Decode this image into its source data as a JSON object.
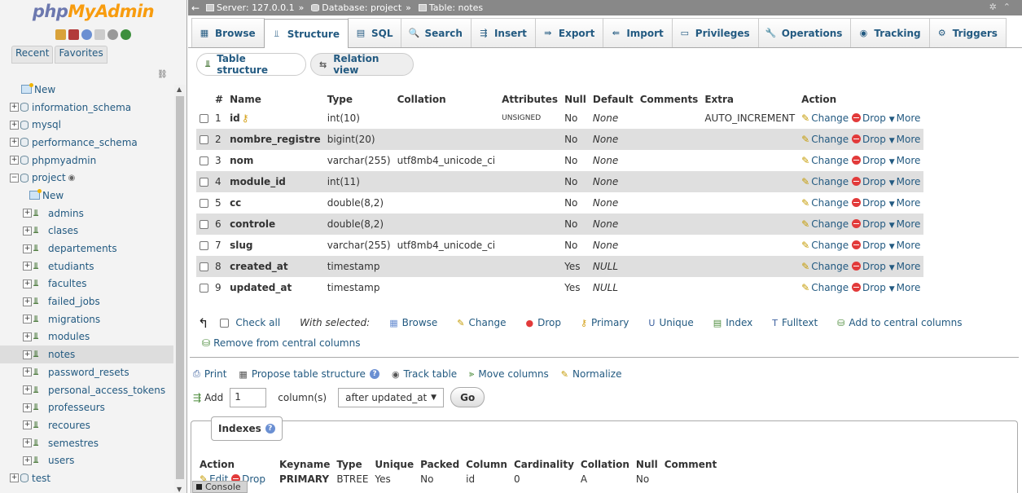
{
  "nav": {
    "logo_part1": "php",
    "logo_part2": "MyAdmin",
    "tabs": [
      "Recent",
      "Favorites"
    ],
    "items": [
      {
        "label": "New",
        "kind": "new",
        "level": 0
      },
      {
        "label": "information_schema",
        "kind": "db",
        "level": 0
      },
      {
        "label": "mysql",
        "kind": "db",
        "level": 0
      },
      {
        "label": "performance_schema",
        "kind": "db",
        "level": 0
      },
      {
        "label": "phpmyadmin",
        "kind": "db",
        "level": 0
      },
      {
        "label": "project",
        "kind": "db-open",
        "level": 0
      },
      {
        "label": "New",
        "kind": "new",
        "level": 1
      },
      {
        "label": "admins",
        "kind": "table",
        "level": 1
      },
      {
        "label": "clases",
        "kind": "table",
        "level": 1
      },
      {
        "label": "departements",
        "kind": "table",
        "level": 1
      },
      {
        "label": "etudiants",
        "kind": "table",
        "level": 1
      },
      {
        "label": "facultes",
        "kind": "table",
        "level": 1
      },
      {
        "label": "failed_jobs",
        "kind": "table",
        "level": 1
      },
      {
        "label": "migrations",
        "kind": "table",
        "level": 1
      },
      {
        "label": "modules",
        "kind": "table",
        "level": 1
      },
      {
        "label": "notes",
        "kind": "table",
        "level": 1,
        "selected": true
      },
      {
        "label": "password_resets",
        "kind": "table",
        "level": 1
      },
      {
        "label": "personal_access_tokens",
        "kind": "table",
        "level": 1
      },
      {
        "label": "professeurs",
        "kind": "table",
        "level": 1
      },
      {
        "label": "recoures",
        "kind": "table",
        "level": 1
      },
      {
        "label": "semestres",
        "kind": "table",
        "level": 1
      },
      {
        "label": "users",
        "kind": "table",
        "level": 1
      },
      {
        "label": "test",
        "kind": "db",
        "level": 0
      }
    ]
  },
  "breadcrumb": {
    "server": "Server: 127.0.0.1",
    "database": "Database: project",
    "table": "Table: notes",
    "separator": "»"
  },
  "menu": {
    "tabs": [
      {
        "label": "Browse",
        "icon": "browse-icon",
        "glyph": "▦"
      },
      {
        "label": "Structure",
        "icon": "structure-icon",
        "glyph": "⫫",
        "active": true
      },
      {
        "label": "SQL",
        "icon": "sql-icon",
        "glyph": "▤"
      },
      {
        "label": "Search",
        "icon": "search-icon",
        "glyph": "🔍"
      },
      {
        "label": "Insert",
        "icon": "insert-icon",
        "glyph": "⇶"
      },
      {
        "label": "Export",
        "icon": "export-icon",
        "glyph": "⇛"
      },
      {
        "label": "Import",
        "icon": "import-icon",
        "glyph": "⇚"
      },
      {
        "label": "Privileges",
        "icon": "privileges-icon",
        "glyph": "▭"
      },
      {
        "label": "Operations",
        "icon": "operations-icon",
        "glyph": "🔧"
      },
      {
        "label": "Tracking",
        "icon": "tracking-icon",
        "glyph": "◉"
      },
      {
        "label": "Triggers",
        "icon": "triggers-icon",
        "glyph": "⚙"
      }
    ]
  },
  "subtabs": {
    "table_structure": "Table structure",
    "relation_view": "Relation view"
  },
  "structure": {
    "headers": [
      "#",
      "Name",
      "Type",
      "Collation",
      "Attributes",
      "Null",
      "Default",
      "Comments",
      "Extra",
      "Action"
    ],
    "rows": [
      {
        "num": "1",
        "name": "id",
        "primary": true,
        "type": "int(10)",
        "collation": "",
        "attributes": "UNSIGNED",
        "null": "No",
        "default": "None",
        "comments": "",
        "extra": "AUTO_INCREMENT"
      },
      {
        "num": "2",
        "name": "nombre_registre",
        "type": "bigint(20)",
        "collation": "",
        "attributes": "",
        "null": "No",
        "default": "None",
        "comments": "",
        "extra": ""
      },
      {
        "num": "3",
        "name": "nom",
        "type": "varchar(255)",
        "collation": "utf8mb4_unicode_ci",
        "attributes": "",
        "null": "No",
        "default": "None",
        "comments": "",
        "extra": ""
      },
      {
        "num": "4",
        "name": "module_id",
        "type": "int(11)",
        "collation": "",
        "attributes": "",
        "null": "No",
        "default": "None",
        "comments": "",
        "extra": ""
      },
      {
        "num": "5",
        "name": "cc",
        "type": "double(8,2)",
        "collation": "",
        "attributes": "",
        "null": "No",
        "default": "None",
        "comments": "",
        "extra": ""
      },
      {
        "num": "6",
        "name": "controle",
        "type": "double(8,2)",
        "collation": "",
        "attributes": "",
        "null": "No",
        "default": "None",
        "comments": "",
        "extra": ""
      },
      {
        "num": "7",
        "name": "slug",
        "type": "varchar(255)",
        "collation": "utf8mb4_unicode_ci",
        "attributes": "",
        "null": "No",
        "default": "None",
        "comments": "",
        "extra": ""
      },
      {
        "num": "8",
        "name": "created_at",
        "type": "timestamp",
        "collation": "",
        "attributes": "",
        "null": "Yes",
        "default": "NULL",
        "comments": "",
        "extra": ""
      },
      {
        "num": "9",
        "name": "updated_at",
        "type": "timestamp",
        "collation": "",
        "attributes": "",
        "null": "Yes",
        "default": "NULL",
        "comments": "",
        "extra": ""
      }
    ],
    "row_actions": {
      "change": "Change",
      "drop": "Drop",
      "more": "More"
    }
  },
  "with_selected": {
    "check_all": "Check all",
    "label": "With selected:",
    "actions": [
      {
        "label": "Browse",
        "icon": "browse-icon",
        "glyph": "▦",
        "color": "#6a8fd2"
      },
      {
        "label": "Change",
        "icon": "pencil-icon",
        "glyph": "✎",
        "color": "#c49a00"
      },
      {
        "label": "Drop",
        "icon": "drop-icon",
        "glyph": "●",
        "color": "#e23a3a"
      },
      {
        "label": "Primary",
        "icon": "key-icon",
        "glyph": "⚷",
        "color": "#d4a017"
      },
      {
        "label": "Unique",
        "icon": "unique-icon",
        "glyph": "U",
        "color": "#3a5f9e"
      },
      {
        "label": "Index",
        "icon": "index-icon",
        "glyph": "▤",
        "color": "#4b8b3b"
      },
      {
        "label": "Fulltext",
        "icon": "fulltext-icon",
        "glyph": "T",
        "color": "#3a5f9e"
      },
      {
        "label": "Add to central columns",
        "icon": "central-columns-icon",
        "glyph": "⛁",
        "color": "#4b8b3b"
      }
    ],
    "remove_central": "Remove from central columns"
  },
  "tools": {
    "print": "Print",
    "propose": "Propose table structure",
    "track": "Track table",
    "move": "Move columns",
    "normalize": "Normalize"
  },
  "add_columns": {
    "label": "Add",
    "count": "1",
    "suffix": "column(s)",
    "position": "after updated_at",
    "go": "Go"
  },
  "indexes": {
    "title": "Indexes",
    "headers": [
      "Action",
      "Keyname",
      "Type",
      "Unique",
      "Packed",
      "Column",
      "Cardinality",
      "Collation",
      "Null",
      "Comment"
    ],
    "rows": [
      {
        "edit": "Edit",
        "drop": "Drop",
        "keyname": "PRIMARY",
        "type": "BTREE",
        "unique": "Yes",
        "packed": "No",
        "column": "id",
        "cardinality": "0",
        "collation": "A",
        "null": "No",
        "comment": ""
      }
    ]
  },
  "console": "Console"
}
